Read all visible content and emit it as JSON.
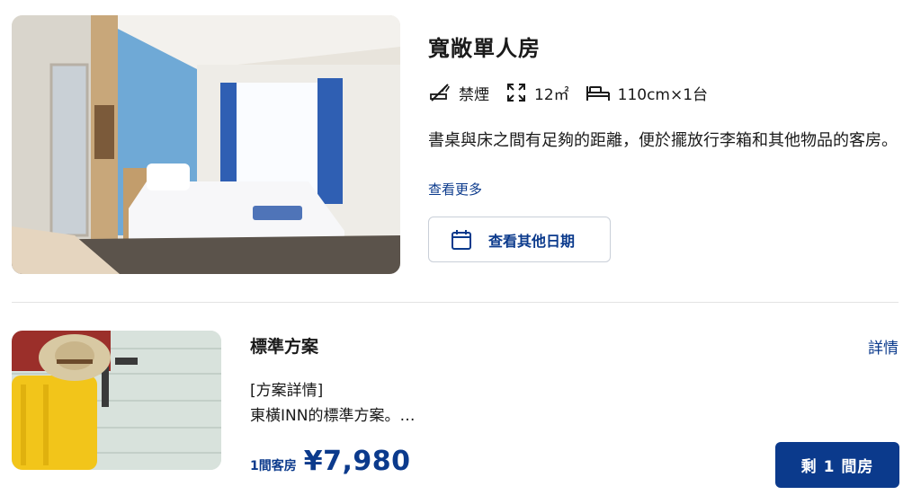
{
  "room": {
    "name": "寬敞單人房",
    "features": [
      {
        "icon": "no-smoking-icon",
        "label": "禁煙"
      },
      {
        "icon": "room-size-icon",
        "label": "12㎡"
      },
      {
        "icon": "bed-icon",
        "label": "110cm×1台"
      }
    ],
    "description": "書桌與床之間有足夠的距離，便於擺放行李箱和其他物品的客房。",
    "see_more_label": "查看更多",
    "other_dates_label": "查看其他日期"
  },
  "plan": {
    "name": "標準方案",
    "details_link": "詳情",
    "desc_heading": "[方案詳情]",
    "desc_body": "東橫INN的標準方案。…",
    "per_room_label": "1間客房",
    "price": "¥7,980",
    "availability_button": "剩 1 間房"
  },
  "colors": {
    "accent": "#0b3a8c",
    "border": "#c9cfd8",
    "divider": "#e3e3e3",
    "text": "#1a1a1a"
  }
}
